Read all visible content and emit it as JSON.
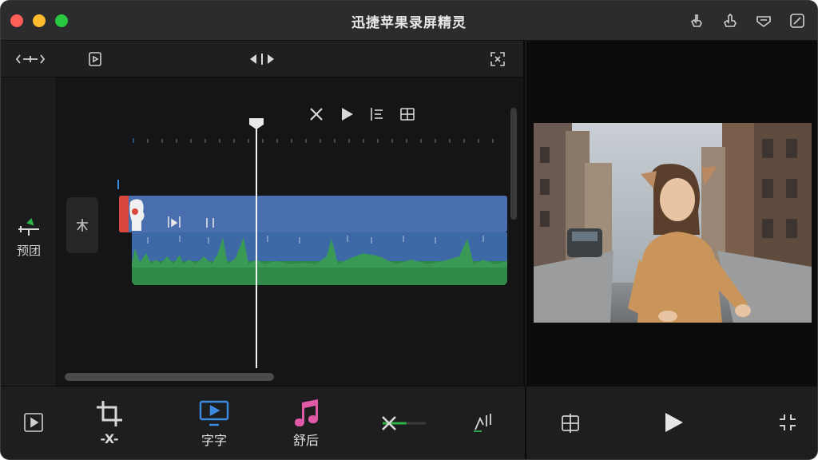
{
  "window": {
    "title": "迅捷苹果录屏精灵"
  },
  "colors": {
    "accent_blue": "#3b8be0",
    "music_pink": "#e05aa8",
    "audio_green": "#2f8a49",
    "video_blue": "#4a6fae",
    "clip_red": "#d9473c"
  },
  "titlebar_icons": [
    "crop-hand-icon",
    "share-hand-icon",
    "export-icon",
    "edit-icon"
  ],
  "editor_toolbar": {
    "left_icons": [
      "expand-arrows-icon",
      "clip-frame-icon"
    ],
    "center_icon": "snap-arrows-icon",
    "right_icon": "fullscreen-icon"
  },
  "clip_toolbar": [
    "cut-icon",
    "play-icon",
    "split-icon",
    "grid-icon"
  ],
  "track": {
    "label": "预团"
  },
  "bottom_tools": [
    {
      "icon": "crop-icon",
      "label": "-X-"
    },
    {
      "icon": "subtitle-monitor-icon",
      "label": "字字"
    },
    {
      "icon": "music-note-icon",
      "label": "舒后"
    }
  ],
  "audio_slider": {
    "level": 0.55
  },
  "preview": {
    "description_visible": false
  },
  "transport": [
    "frame-select-icon",
    "play-icon",
    "shrink-icon"
  ]
}
